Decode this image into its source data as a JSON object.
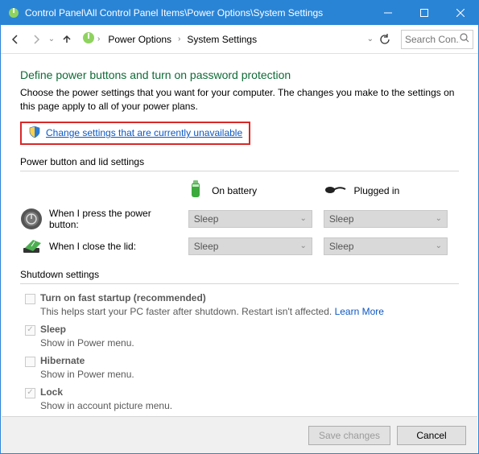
{
  "titlebar": {
    "path": "Control Panel\\All Control Panel Items\\Power Options\\System Settings"
  },
  "breadcrumbs": {
    "item1": "Power Options",
    "item2": "System Settings"
  },
  "search": {
    "placeholder": "Search Con..."
  },
  "page": {
    "heading": "Define power buttons and turn on password protection",
    "subtext": "Choose the power settings that you want for your computer. The changes you make to the settings on this page apply to all of your power plans.",
    "change_link": "Change settings that are currently unavailable"
  },
  "group1": {
    "title": "Power button and lid settings",
    "col_battery": "On battery",
    "col_plugged": "Plugged in",
    "row1_label": "When I press the power button:",
    "row1_b": "Sleep",
    "row1_p": "Sleep",
    "row2_label": "When I close the lid:",
    "row2_b": "Sleep",
    "row2_p": "Sleep"
  },
  "group2": {
    "title": "Shutdown settings",
    "opt1_label": "Turn on fast startup (recommended)",
    "opt1_desc": "This helps start your PC faster after shutdown. Restart isn't affected. ",
    "opt1_more": "Learn More",
    "opt2_label": "Sleep",
    "opt2_desc": "Show in Power menu.",
    "opt3_label": "Hibernate",
    "opt3_desc": "Show in Power menu.",
    "opt4_label": "Lock",
    "opt4_desc": "Show in account picture menu."
  },
  "footer": {
    "save": "Save changes",
    "cancel": "Cancel"
  }
}
